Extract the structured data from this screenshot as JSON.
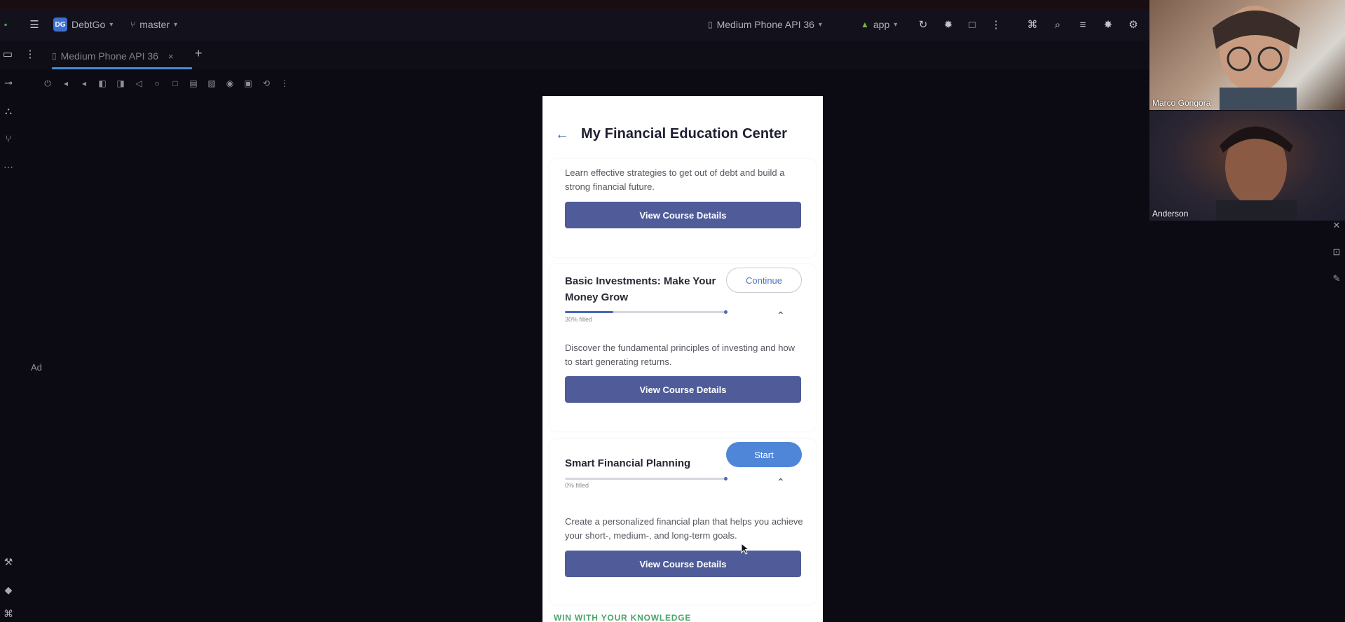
{
  "ide": {
    "project_badge": "DG",
    "project_name": "DebtGo",
    "branch": "master",
    "device_selector": "Medium Phone API 36",
    "run_config": "app",
    "tab_label": "Medium Phone API 36",
    "side_label": "Ad"
  },
  "app": {
    "title": "My Financial Education Center",
    "courses": [
      {
        "description": "Learn effective strategies to get out of debt and build a strong financial future.",
        "details_button": "View Course Details"
      },
      {
        "title": "Basic Investments: Make Your Money Grow",
        "action_button": "Continue",
        "progress_percent": 30,
        "progress_label": "30% filled",
        "description": "Discover the fundamental principles of investing and how to start generating returns.",
        "details_button": "View Course Details"
      },
      {
        "title": "Smart Financial Planning",
        "action_button": "Start",
        "progress_percent": 0,
        "progress_label": "0% filled",
        "description": "Create a personalized financial plan that helps you achieve your short-, medium-, and long-term goals.",
        "details_button": "View Course Details"
      }
    ],
    "section_heading": "WIN WITH YOUR KNOWLEDGE"
  },
  "call": {
    "participants": [
      {
        "name": "Marco Góngora"
      },
      {
        "name": "Anderson"
      }
    ]
  },
  "colors": {
    "primary_button": "#4f5c99",
    "start_button": "#4f86d8",
    "progress": "#4a67b8",
    "section_heading": "#4aa56a"
  }
}
